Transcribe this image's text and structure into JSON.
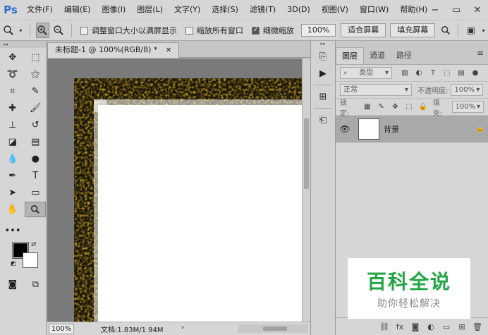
{
  "app": {
    "logo": "Ps"
  },
  "menu": [
    "文件(F)",
    "编辑(E)",
    "图像(I)",
    "图层(L)",
    "文字(Y)",
    "选择(S)",
    "滤镜(T)",
    "3D(D)",
    "视图(V)",
    "窗口(W)",
    "帮助(H)"
  ],
  "options": {
    "resize_windows_label": "调整窗口大小以满屏显示",
    "resize_windows_checked": false,
    "zoom_all_windows_label": "缩放所有窗口",
    "zoom_all_windows_checked": false,
    "scrubby_zoom_label": "细微缩放",
    "scrubby_zoom_checked": true,
    "zoom_value": "100%",
    "fit_screen_label": "适合屏幕",
    "fill_screen_label": "填充屏幕"
  },
  "document": {
    "tab_title": "未标题-1 @ 100%(RGB/8) *",
    "status_zoom": "100%",
    "status_info": "文档:1.83M/1.94M"
  },
  "colors": {
    "foreground": "#000000",
    "background": "#ffffff",
    "texture_gold": "#c9a227"
  },
  "layers_panel": {
    "tabs": [
      "图层",
      "通道",
      "路径"
    ],
    "active_tab": "图层",
    "filter_kind": "类型",
    "blend_mode": "正常",
    "opacity_label": "不透明度:",
    "opacity_value": "100%",
    "lock_label": "锁定:",
    "fill_label": "填充:",
    "fill_value": "100%",
    "layers": [
      {
        "name": "背景",
        "visible": true,
        "locked": true
      }
    ]
  },
  "watermark": {
    "title": "百科全说",
    "subtitle": "助你轻松解决"
  }
}
